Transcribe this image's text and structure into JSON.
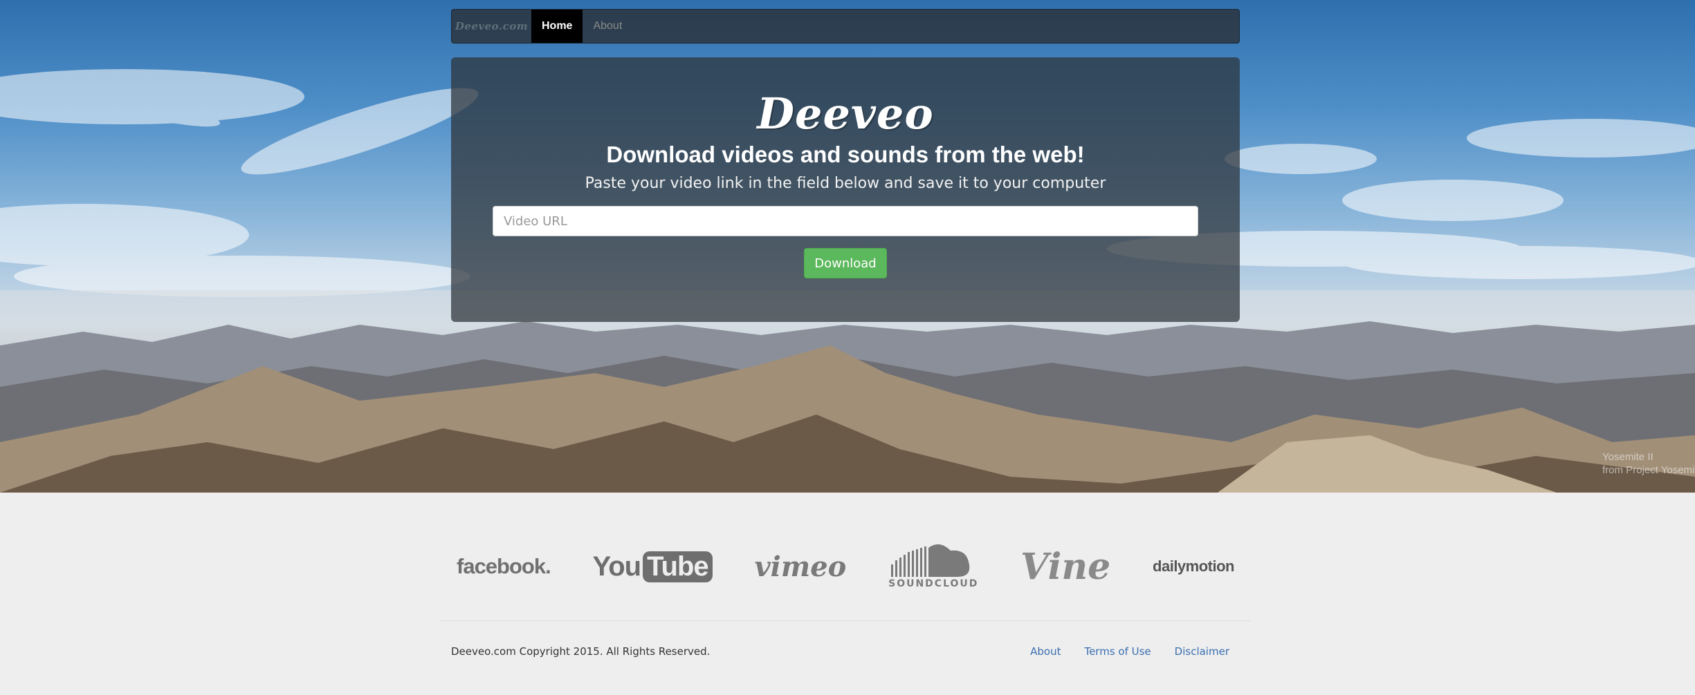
{
  "navbar": {
    "brand": "Deeveo.com",
    "items": [
      {
        "label": "Home",
        "active": true
      },
      {
        "label": "About",
        "active": false
      }
    ]
  },
  "hero": {
    "logo": "Deeveo",
    "headline": "Download videos and sounds from the web!",
    "subline": "Paste your video link in the field below and save it to your computer",
    "url_input": {
      "value": "",
      "placeholder": "Video URL"
    },
    "download_button": "Download",
    "credit_line1": "Yosemite II",
    "credit_line2": "from Project Yosemite"
  },
  "supported_sites": {
    "facebook": "facebook.",
    "youtube_you": "You",
    "youtube_tube": "Tube",
    "vimeo": "vimeo",
    "soundcloud": "SOUNDCLOUD",
    "vine": "Vine",
    "dailymotion": "dailymotion"
  },
  "footer": {
    "copyright": "Deeveo.com Copyright 2015. All Rights Reserved.",
    "links": [
      "About",
      "Terms of Use",
      "Disclaimer"
    ]
  },
  "colors": {
    "download_button": "#5cb85c",
    "footer_link": "#3a6fb0",
    "page_background": "#eeeeee"
  }
}
